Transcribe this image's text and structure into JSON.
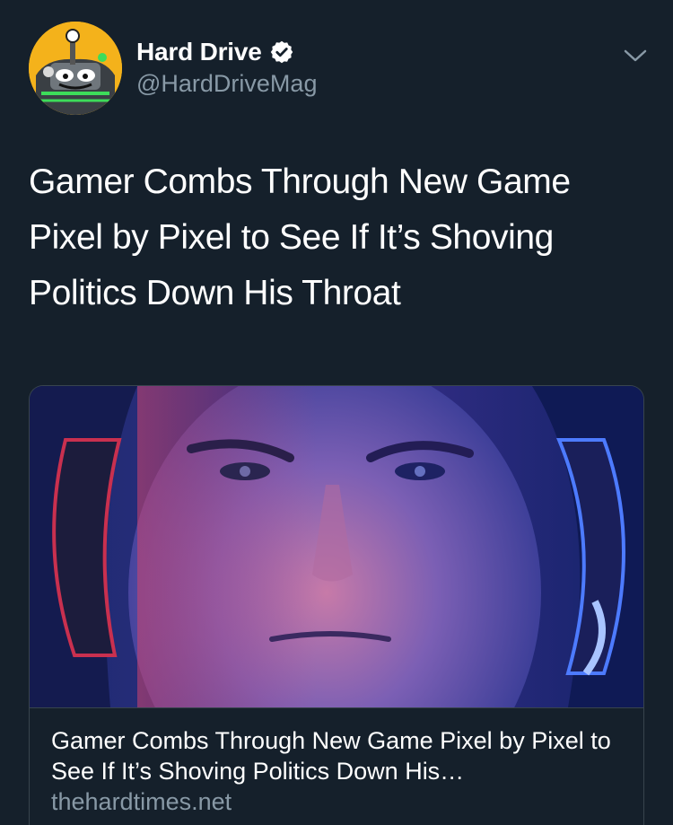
{
  "author": {
    "display_name": "Hard Drive",
    "handle": "@HardDriveMag",
    "verified": true,
    "avatar_icon": "joystick-mascot-avatar"
  },
  "tweet": {
    "text": "Gamer Combs Through New Game Pixel by Pixel to See If It’s Shoving Politics Down His Throat"
  },
  "card": {
    "title": "Gamer Combs Through New Game Pixel by Pixel to See If It’s Shoving Politics Down His…",
    "domain": "thehardtimes.net",
    "image_icon": "gamer-headphones-photo"
  },
  "colors": {
    "background": "#15202b",
    "secondary_text": "#8899a6",
    "border": "#38444d",
    "verified": "#ffffff"
  }
}
